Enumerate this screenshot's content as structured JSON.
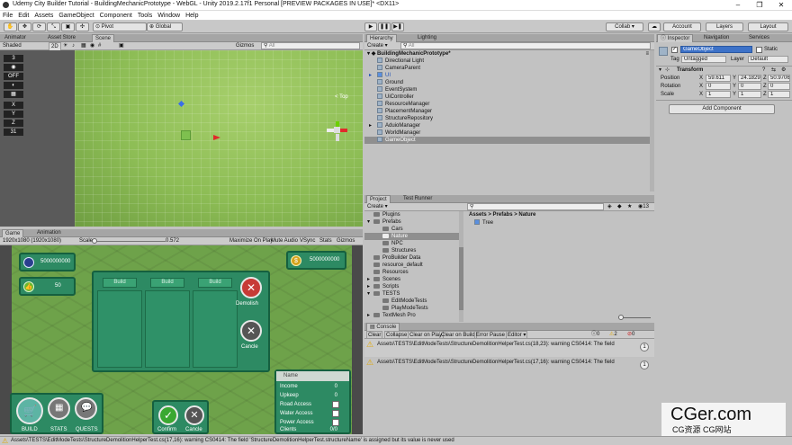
{
  "window": {
    "title": "Udemy City Builder Tutorial - BuildingMechanicPrototype - WebGL - Unity 2019.2.17f1 Personal [PREVIEW PACKAGES IN USE]* <DX11>"
  },
  "menu": [
    "File",
    "Edit",
    "Assets",
    "GameObject",
    "Component",
    "Tools",
    "Window",
    "Help"
  ],
  "toolbar": {
    "pivot": "Pivot",
    "global": "Global",
    "collab": "Collab ▾",
    "account": "Account",
    "layers": "Layers",
    "layout": "Layout"
  },
  "scene_panel": {
    "tabs": [
      "Animator",
      "Asset Store",
      "Scene"
    ],
    "shading": "Shaded",
    "mode_2d": "2D",
    "gizmos": "Gizmos",
    "search_placeholder": "All",
    "gizmo_persp": "< Top"
  },
  "scene_overlay": [
    "3",
    "",
    "OFF",
    "",
    "",
    "X",
    "Y",
    "Z",
    "31"
  ],
  "game_panel": {
    "tabs": [
      "Game",
      "Animation"
    ],
    "resolution": "1920x1080 (1920x1080)",
    "scale_label": "Scale",
    "scale_value": "0.572",
    "options": [
      "Maximize On Play",
      "Mute Audio",
      "VSync",
      "Stats",
      "Gizmos"
    ]
  },
  "game_ui": {
    "money_left": "5000000000",
    "money_right": "5000000000",
    "thumbs_count": "50",
    "build_buttons": [
      "Build",
      "Build",
      "Build"
    ],
    "demolish": "Demolish",
    "cancel": "Cancle",
    "bottom_left": [
      "BUILD",
      "STATS",
      "QUESTS"
    ],
    "confirm": "Confirm",
    "confirm_cancel": "Cancle",
    "stats_title": "Name",
    "stats": [
      {
        "label": "Income",
        "value": "0"
      },
      {
        "label": "Upkeep",
        "value": "0"
      },
      {
        "label": "Road Access",
        "value": ""
      },
      {
        "label": "Water Access",
        "value": ""
      },
      {
        "label": "Power Access",
        "value": ""
      },
      {
        "label": "Clients",
        "value": "0/0"
      }
    ],
    "colors": {
      "panel": "#2d8a63",
      "panel_border": "#15603f",
      "demolish_red": "#c73b36"
    }
  },
  "hierarchy": {
    "tabs": [
      "Hierarchy",
      "Lighting"
    ],
    "create": "Create ▾",
    "search_placeholder": "All",
    "scene": "BuildingMechanicPrototype*",
    "items": [
      "Directional Light",
      "CameraParent",
      "UI",
      "Ground",
      "EventSystem",
      "UiController",
      "ResourceManager",
      "PlacementManager",
      "StructureRepository",
      "AduioManager",
      "WorldManager",
      "GameObject"
    ]
  },
  "project": {
    "tabs": [
      "Project",
      "Test Runner"
    ],
    "create": "Create ▾",
    "count": "13",
    "folders": [
      "Plugins",
      "Prefabs",
      "Cars",
      "Nature",
      "NPC",
      "Structures",
      "ProBuilder Data",
      "resource_default",
      "Resources",
      "Scenes",
      "Scripts",
      "TESTS",
      "EditModeTests",
      "PlayModeTests",
      "TextMesh Pro"
    ],
    "breadcrumb": [
      "Assets",
      "Prefabs",
      "Nature"
    ],
    "assets": [
      "Tree"
    ]
  },
  "console": {
    "tab": "Console",
    "buttons": [
      "Clear",
      "Collapse",
      "Clear on Play",
      "Clear on Build",
      "Error Pause",
      "Editor ▾"
    ],
    "counts": [
      "0",
      "2",
      "0"
    ],
    "messages": [
      "Assets\\TESTS\\EditModeTests\\StructureDemolitionHelperTest.cs(18,23): warning CS0414: The field",
      "Assets\\TESTS\\EditModeTests\\StructureDemolitionHelperTest.cs(17,16): warning CS0414: The field"
    ],
    "badge": "1"
  },
  "inspector": {
    "tabs": [
      "Inspector",
      "Navigation",
      "Services"
    ],
    "object_name": "GameObject",
    "static": "Static",
    "tag_label": "Tag",
    "tag": "Untagged",
    "layer_label": "Layer",
    "layer": "Default",
    "transform": "Transform",
    "position": {
      "label": "Position",
      "x": "59.611",
      "y": "24.1829",
      "z": "50.9706"
    },
    "rotation": {
      "label": "Rotation",
      "x": "0",
      "y": "0",
      "z": "0"
    },
    "scale": {
      "label": "Scale",
      "x": "1",
      "y": "1",
      "z": "1"
    },
    "add_component": "Add Component"
  },
  "status_bar": "Assets\\TESTS\\EditModeTests\\StructureDemolitionHelperTest.cs(17,16): warning CS0414: The field 'StructureDemolitionHelperTest.structureName' is assigned but its value is never used",
  "watermark": {
    "main": "CGer.com",
    "sub": "CG资源 CG网站"
  }
}
